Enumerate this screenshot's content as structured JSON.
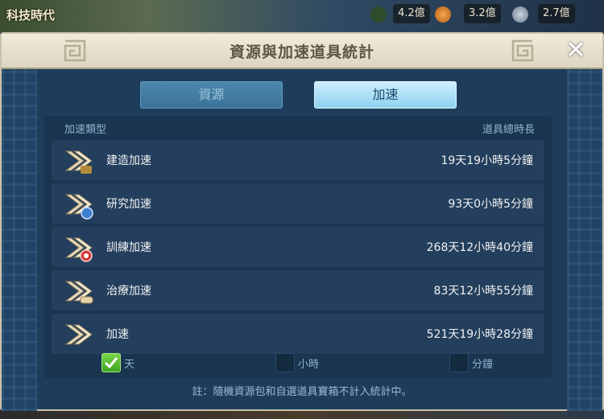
{
  "background": {
    "top_left_title": "科技時代",
    "resources": [
      {
        "value": "4.2億",
        "icon": "food-icon"
      },
      {
        "value": "3.2億",
        "icon": "wood-icon"
      },
      {
        "value": "2.7億",
        "icon": "stone-icon"
      }
    ]
  },
  "dialog": {
    "title": "資源與加速道具統計",
    "close_icon": "close-icon"
  },
  "tabs": [
    {
      "label": "資源",
      "selected": false
    },
    {
      "label": "加速",
      "selected": true
    }
  ],
  "table": {
    "header_type": "加速類型",
    "header_total": "道具總時長",
    "rows": [
      {
        "name": "建造加速",
        "value": "19天19小時5分鐘",
        "icon": "build-speedup-icon"
      },
      {
        "name": "研究加速",
        "value": "93天0小時5分鐘",
        "icon": "research-speedup-icon"
      },
      {
        "name": "訓練加速",
        "value": "268天12小時40分鐘",
        "icon": "training-speedup-icon"
      },
      {
        "name": "治療加速",
        "value": "83天12小時55分鐘",
        "icon": "healing-speedup-icon"
      },
      {
        "name": "加速",
        "value": "521天19小時28分鐘",
        "icon": "universal-speedup-icon"
      }
    ]
  },
  "unit_options": [
    {
      "label": "天",
      "checked": true
    },
    {
      "label": "小時",
      "checked": false
    },
    {
      "label": "分鐘",
      "checked": false
    }
  ],
  "footnote": "註：隨機資源包和自選道具寶箱不計入統計中。",
  "colors": {
    "panel_bg": "#1a3550",
    "row_bg": "#233f5d",
    "tab_active": "#8fd2f0",
    "check_on": "#3ea323"
  }
}
